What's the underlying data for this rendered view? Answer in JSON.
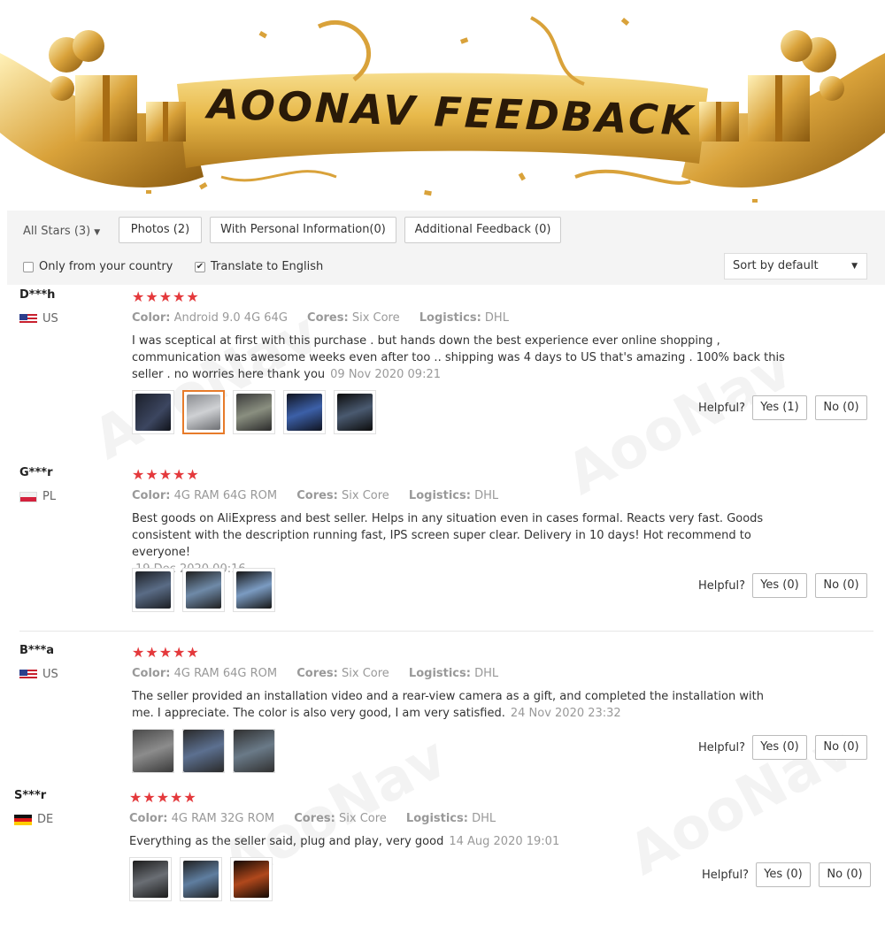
{
  "banner": {
    "title": "AOONAV FEEDBACK"
  },
  "filters": {
    "all_stars": "All Stars (3)",
    "photos": "Photos (2)",
    "personal_info": "With Personal Information(0)",
    "additional": "Additional Feedback (0)",
    "only_country": "Only from your country",
    "only_country_checked": false,
    "translate": "Translate to English",
    "translate_checked": true,
    "sort": "Sort by default"
  },
  "labels": {
    "color": "Color:",
    "cores": "Cores:",
    "logistics": "Logistics:",
    "helpful": "Helpful?"
  },
  "watermark": "AooNav",
  "reviews": [
    {
      "name": "D***h",
      "country": "US",
      "stars": "★★★★★",
      "color": "Android 9.0 4G 64G",
      "cores": "Six Core",
      "logistics": "DHL",
      "text": "I was sceptical at first with this purchase . but hands down the best experience ever online shopping , communication was awesome weeks even after too .. shipping was 4 days to US that's amazing . 100% back this seller . no worries here thank you",
      "date": "09 Nov 2020 09:21",
      "yes": "Yes (1)",
      "no": "No (0)"
    },
    {
      "name": "G***r",
      "country": "PL",
      "stars": "★★★★★",
      "color": "4G RAM 64G ROM",
      "cores": "Six Core",
      "logistics": "DHL",
      "text": "Best goods on AliExpress and best seller. Helps in any situation even in cases formal. Reacts very fast. Goods consistent with the description running fast, IPS screen super clear. Delivery in 10 days! Hot recommend to everyone!",
      "date": "19 Dec 2020 00:16",
      "yes": "Yes (0)",
      "no": "No (0)"
    },
    {
      "name": "B***a",
      "country": "US",
      "stars": "★★★★★",
      "color": "4G RAM 64G ROM",
      "cores": "Six Core",
      "logistics": "DHL",
      "text": "The seller provided an installation video and a rear-view camera as a gift, and completed the installation with me. I appreciate. The color is also very good, I am very satisfied.",
      "date": "24 Nov 2020 23:32",
      "yes": "Yes (0)",
      "no": "No (0)"
    },
    {
      "name": "S***r",
      "country": "DE",
      "stars": "★★★★★",
      "color": "4G RAM 32G ROM",
      "cores": "Six Core",
      "logistics": "DHL",
      "text": "Everything as the seller said, plug and play, very good",
      "date": "14 Aug 2020 19:01",
      "yes": "Yes (0)",
      "no": "No (0)"
    }
  ]
}
